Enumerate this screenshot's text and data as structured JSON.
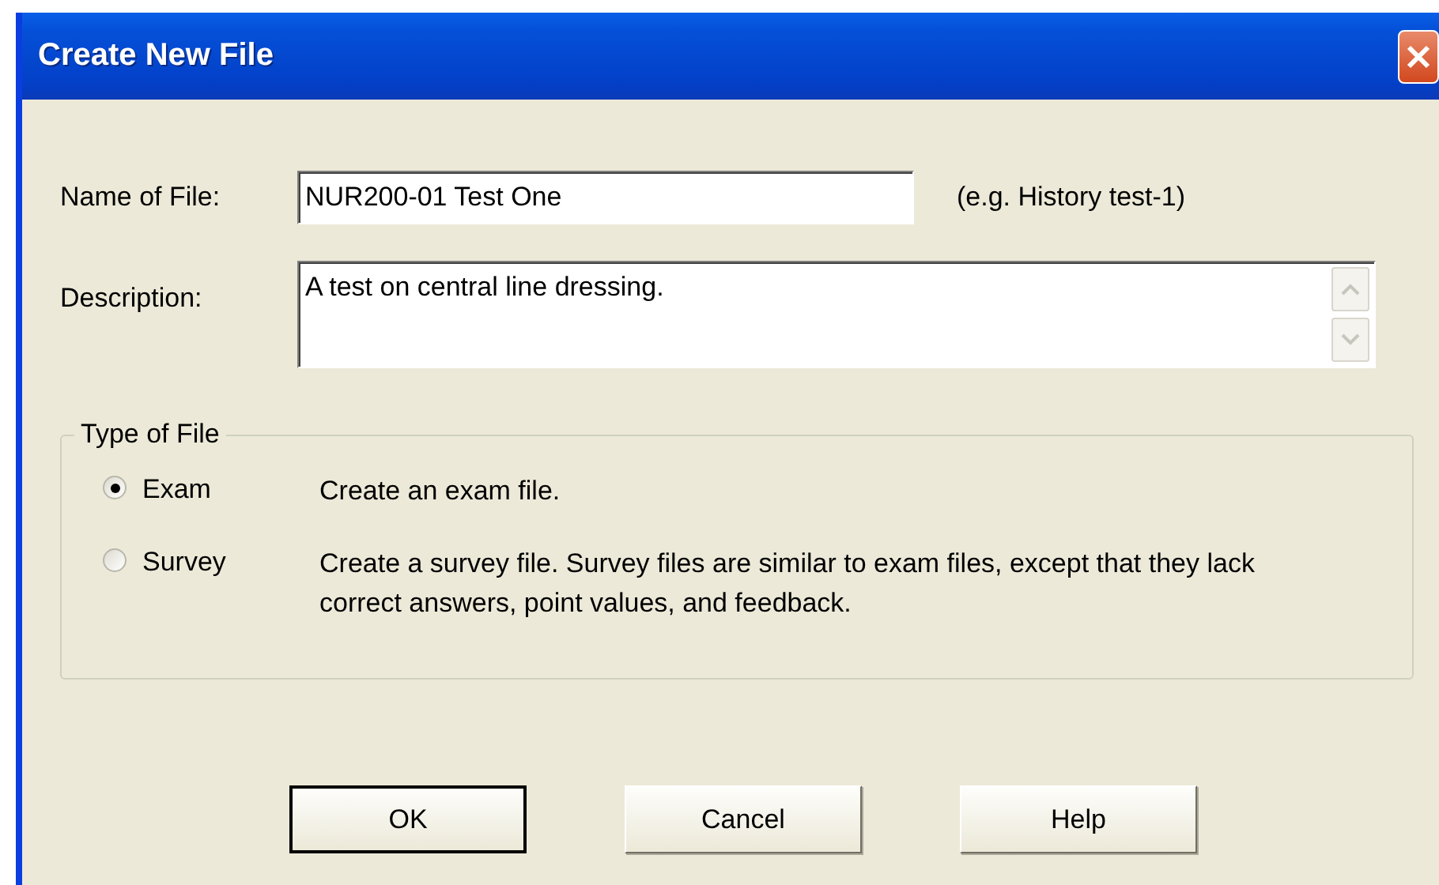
{
  "window": {
    "title": "Create New File"
  },
  "name_field": {
    "label": "Name of File:",
    "value": "NUR200-01 Test One",
    "hint": "(e.g. History test-1)"
  },
  "description_field": {
    "label": "Description:",
    "value": "A test on central line dressing."
  },
  "type_group": {
    "legend": "Type of File",
    "options": [
      {
        "label": "Exam",
        "description": "Create an exam file.",
        "selected": true
      },
      {
        "label": "Survey",
        "description": "Create a survey file.  Survey files are similar to exam files, except that they lack correct answers, point values, and feedback.",
        "selected": false
      }
    ]
  },
  "buttons": [
    {
      "label": "OK",
      "default": true
    },
    {
      "label": "Cancel",
      "default": false
    },
    {
      "label": "Help",
      "default": false
    }
  ]
}
